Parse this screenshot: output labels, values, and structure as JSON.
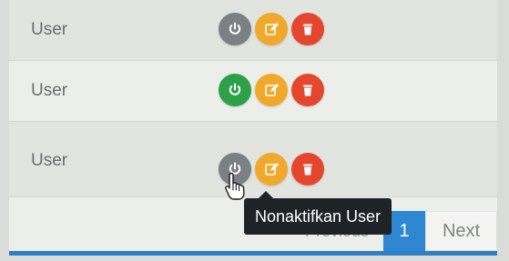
{
  "rows": [
    {
      "label": "User",
      "status": "inactive"
    },
    {
      "label": "User",
      "status": "active"
    },
    {
      "label": "User",
      "status": "inactive"
    }
  ],
  "actions": {
    "toggle_icon": "power-icon",
    "edit_icon": "edit-icon",
    "delete_icon": "trash-icon",
    "colors": {
      "toggle_inactive": "#7b8085",
      "toggle_active": "#2fa04a",
      "edit": "#f0a92a",
      "delete": "#e4472e"
    }
  },
  "tooltip": {
    "text": "Nonaktifkan User"
  },
  "pagination": {
    "previous": "Previous",
    "current": "1",
    "next": "Next"
  },
  "colors": {
    "accent": "#2f86d1"
  }
}
